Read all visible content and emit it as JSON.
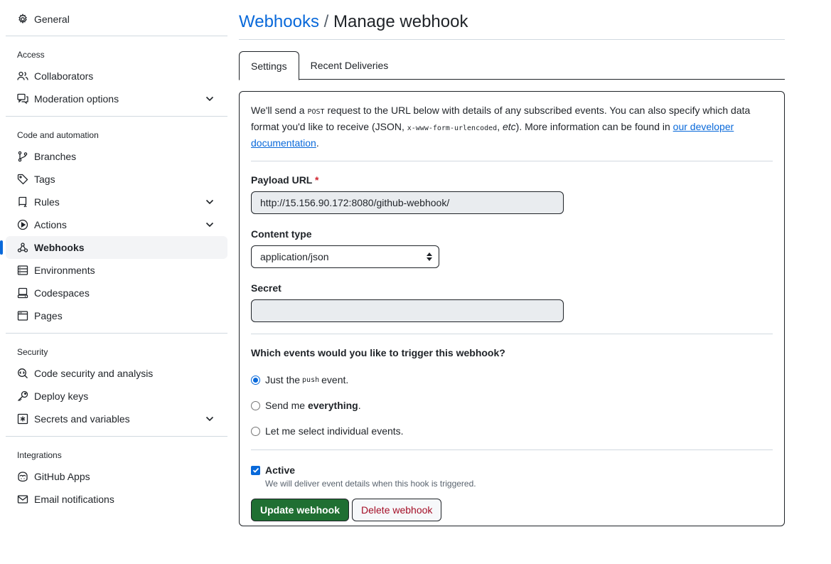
{
  "sidebar": {
    "general": "General",
    "sections": [
      {
        "heading": "Access",
        "items": [
          {
            "label": "Collaborators",
            "icon": "people-icon",
            "chevron": false
          },
          {
            "label": "Moderation options",
            "icon": "comment-discussion-icon",
            "chevron": true
          }
        ]
      },
      {
        "heading": "Code and automation",
        "items": [
          {
            "label": "Branches",
            "icon": "git-branch-icon",
            "chevron": false
          },
          {
            "label": "Tags",
            "icon": "tag-icon",
            "chevron": false
          },
          {
            "label": "Rules",
            "icon": "repo-push-icon",
            "chevron": true
          },
          {
            "label": "Actions",
            "icon": "play-icon",
            "chevron": true
          },
          {
            "label": "Webhooks",
            "icon": "webhook-icon",
            "chevron": false,
            "active": true
          },
          {
            "label": "Environments",
            "icon": "server-icon",
            "chevron": false
          },
          {
            "label": "Codespaces",
            "icon": "codespaces-icon",
            "chevron": false
          },
          {
            "label": "Pages",
            "icon": "browser-icon",
            "chevron": false
          }
        ]
      },
      {
        "heading": "Security",
        "items": [
          {
            "label": "Code security and analysis",
            "icon": "codescan-icon",
            "chevron": false
          },
          {
            "label": "Deploy keys",
            "icon": "key-icon",
            "chevron": false
          },
          {
            "label": "Secrets and variables",
            "icon": "key-asterisk-icon",
            "chevron": true
          }
        ]
      },
      {
        "heading": "Integrations",
        "items": [
          {
            "label": "GitHub Apps",
            "icon": "copilot-apps-icon",
            "chevron": false
          },
          {
            "label": "Email notifications",
            "icon": "mail-icon",
            "chevron": false
          }
        ]
      }
    ]
  },
  "header": {
    "breadcrumb_link": "Webhooks",
    "separator": " / ",
    "title": "Manage webhook"
  },
  "tabs": [
    {
      "label": "Settings",
      "selected": true
    },
    {
      "label": "Recent Deliveries",
      "selected": false
    }
  ],
  "form": {
    "intro_1": "We'll send a ",
    "intro_code_1": "POST",
    "intro_2": " request to the URL below with details of any subscribed events. You can also specify which data format you'd like to receive (JSON, ",
    "intro_code_2": "x-www-form-urlencoded",
    "intro_3": ", ",
    "intro_etc": "etc",
    "intro_4": "). More information can be found in ",
    "intro_link": "our developer documentation",
    "intro_5": ".",
    "payload_label": "Payload URL",
    "required_mark": "*",
    "payload_value": "http://15.156.90.172:8080/github-webhook/",
    "content_type_label": "Content type",
    "content_type_value": "application/json",
    "secret_label": "Secret",
    "secret_value": "",
    "events_question": "Which events would you like to trigger this webhook?",
    "event_options": [
      {
        "pre": "Just the ",
        "code": "push",
        "post": " event.",
        "bold": "",
        "checked": true
      },
      {
        "pre": "Send me ",
        "code": "",
        "post": ".",
        "bold": "everything",
        "checked": false
      },
      {
        "pre": "Let me select individual events.",
        "code": "",
        "post": "",
        "bold": "",
        "checked": false
      }
    ],
    "active_label": "Active",
    "active_checked": true,
    "active_note": "We will deliver event details when this hook is triggered.",
    "update_button": "Update webhook",
    "delete_button": "Delete webhook"
  },
  "colors": {
    "accent": "#0969da",
    "primary_button": "#1f6f32",
    "danger_text": "#a40e26"
  }
}
